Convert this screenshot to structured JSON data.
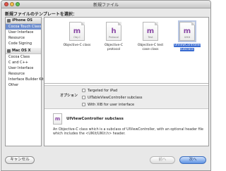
{
  "window": {
    "title": "新規ファイル"
  },
  "prompt": "新規ファイルのテンプレートを選択：",
  "sidebar": {
    "groups": [
      {
        "label": "iPhone OS",
        "icon": "iphone-icon",
        "items": [
          "Cocoa Touch Class",
          "User Interface",
          "Resource",
          "Code Signing"
        ],
        "selected": 0
      },
      {
        "label": "Mac OS X",
        "icon": "mac-icon",
        "items": [
          "Cocoa Class",
          "C and C++",
          "User Interface",
          "Resource",
          "Interface Builder Kit",
          "Other"
        ],
        "selected": null
      }
    ]
  },
  "templates": [
    {
      "glyph": "m",
      "ext": "Obj-C",
      "caption": "Objective-C class",
      "selected": false
    },
    {
      "glyph": "h",
      "ext": "Protocol",
      "caption": "Objective-C protocol",
      "selected": false
    },
    {
      "glyph": "m",
      "ext": "Test",
      "caption": "Objective-C test case class",
      "selected": false
    },
    {
      "glyph": "m",
      "ext": "UIKit",
      "caption": "UIViewController subclass",
      "selected": true
    }
  ],
  "options": {
    "label": "オプション",
    "items": [
      {
        "label": "Targeted for iPad",
        "checked": false
      },
      {
        "label": "UITableViewController subclass",
        "checked": false
      },
      {
        "label": "With XIB for user interface",
        "checked": false
      }
    ]
  },
  "description": {
    "icon_glyph": "m",
    "title": "UIViewController subclass",
    "body": "An Objective-C class which is a subclass of UIViewController, with an optional header file which includes the <UIKit/UIKit.h> header."
  },
  "buttons": {
    "cancel": "キャンセル",
    "previous": "前へ",
    "next": "次へ"
  },
  "colors": {
    "selection": "#3a6cd1",
    "sidebar_selection": "#6f8fcf",
    "template_glyph": "#8b4aa6",
    "primary_button": "#5f93e3"
  }
}
